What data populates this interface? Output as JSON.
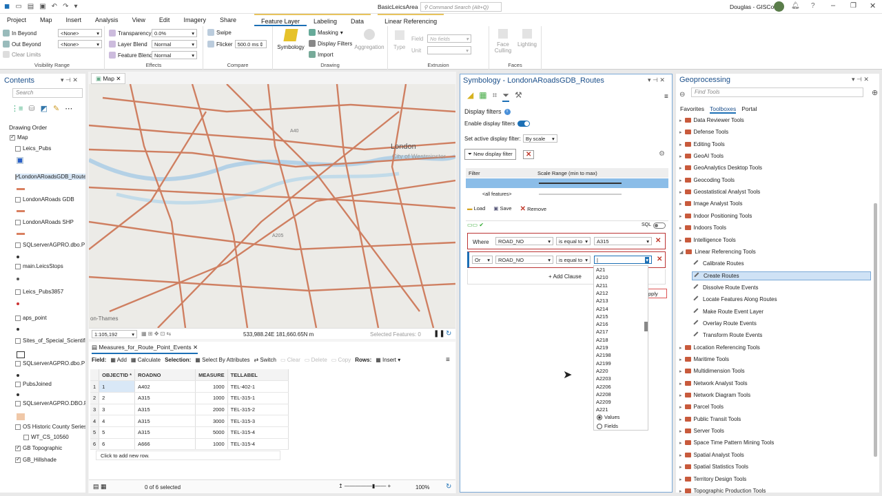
{
  "app": {
    "project_name": "BasicLeicsArea",
    "command_search_placeholder": "Command Search (Alt+Q)",
    "user": "Douglas - GISCo"
  },
  "tabs": [
    "Project",
    "Map",
    "Insert",
    "Analysis",
    "View",
    "Edit",
    "Imagery",
    "Share",
    "Feature Layer",
    "Labeling",
    "Data",
    "Linear Referencing"
  ],
  "ribbon": {
    "visibility_range": {
      "label": "Visibility Range",
      "in_beyond": "In Beyond",
      "out_beyond": "Out Beyond",
      "clear_limits": "Clear Limits",
      "in_value": "<None>",
      "out_value": "<None>"
    },
    "effects": {
      "label": "Effects",
      "transparency": "Transparency",
      "transparency_value": "0.0%",
      "layer_blend": "Layer Blend",
      "layer_blend_value": "Normal",
      "feature_blend": "Feature Blend",
      "feature_blend_value": "Normal"
    },
    "compare": {
      "label": "Compare",
      "swipe": "Swipe",
      "flicker": "Flicker",
      "flicker_value": "500.0 ms"
    },
    "drawing": {
      "label": "Drawing",
      "symbology": "Symbology",
      "masking": "Masking",
      "display_filters": "Display Filters",
      "import": "Import",
      "aggregation": "Aggregation"
    },
    "extrusion": {
      "label": "Extrusion",
      "type": "Type",
      "field": "Field",
      "field_value": "No fields",
      "unit": "Unit"
    },
    "faces": {
      "label": "Faces",
      "face_culling": "Face Culling",
      "lighting": "Lighting"
    }
  },
  "contents": {
    "title": "Contents",
    "search_placeholder": "Search",
    "drawing_order": "Drawing Order",
    "layers": [
      {
        "name": "Map",
        "checked": true
      },
      {
        "name": "Leics_Pubs",
        "checked": false
      },
      {
        "name": "LondonARoadsGDB_Route",
        "checked": true
      },
      {
        "name": "LondonARoads GDB",
        "checked": false
      },
      {
        "name": "LondonARoads SHP",
        "checked": false
      },
      {
        "name": "SQLserverAGPRO.dbo.P",
        "checked": false
      },
      {
        "name": "main.LeicsStops",
        "checked": false
      },
      {
        "name": "Leics_Pubs3857",
        "checked": false
      },
      {
        "name": "aps_point",
        "checked": false
      },
      {
        "name": "Sites_of_Special_Scientific",
        "checked": false
      },
      {
        "name": "SQLserverAGPRO.dbo.P",
        "checked": false
      },
      {
        "name": "PubsJoined",
        "checked": false
      },
      {
        "name": "SQLserverAGPRO.DBO.P",
        "checked": false
      },
      {
        "name": "OS Historic County Series",
        "checked": false
      },
      {
        "name": "WT_CS_10560",
        "checked": false
      },
      {
        "name": "GB Topographic",
        "checked": true
      },
      {
        "name": "GB_Hillshade",
        "checked": true
      }
    ]
  },
  "map": {
    "tab": "Map",
    "scale": "1:105,192",
    "coords": "533,988.24E 181,660.65N m",
    "selected": "Selected Features: 0",
    "labels": {
      "london": "London",
      "westminster": "City of Westminster",
      "thames": "on-Thames",
      "a40": "A40",
      "a205": "A205"
    }
  },
  "table": {
    "tab": "Measures_for_Route_Point_Events",
    "toolbar": {
      "field": "Field:",
      "add": "Add",
      "calculate": "Calculate",
      "selection": "Selection:",
      "select_by_attr": "Select By Attributes",
      "switch": "Switch",
      "clear": "Clear",
      "delete": "Delete",
      "copy": "Copy",
      "rows": "Rows:",
      "insert": "Insert"
    },
    "columns": [
      "OBJECTID *",
      "ROADNO",
      "MEASURE",
      "TELLABEL"
    ],
    "rows": [
      [
        "1",
        "A402",
        "1000",
        "TEL-402-1"
      ],
      [
        "2",
        "A315",
        "1000",
        "TEL-315-1"
      ],
      [
        "3",
        "A315",
        "2000",
        "TEL-315-2"
      ],
      [
        "4",
        "A315",
        "3000",
        "TEL-315-3"
      ],
      [
        "5",
        "A315",
        "5000",
        "TEL-315-4"
      ],
      [
        "6",
        "A666",
        "1000",
        "TEL-315-4"
      ]
    ],
    "add_row": "Click to add new row.",
    "status": "0 of 6 selected",
    "zoom": "100%"
  },
  "symbology": {
    "title": "Symbology - LondonARoadsGDB_Routes",
    "section": "Display filters",
    "enable": "Enable display filters",
    "set_active": "Set active display filter:",
    "active_value": "By scale",
    "new_filter": "New display filter",
    "col_filter": "Filter",
    "col_scale": "Scale Range (min to max)",
    "all_features": "<all features>",
    "load": "Load",
    "save": "Save",
    "remove": "Remove",
    "sql": "SQL",
    "clause1": {
      "prefix": "Where",
      "field": "ROAD_NO",
      "op": "is equal to",
      "value": "A315"
    },
    "clause2": {
      "prefix": "Or",
      "field": "ROAD_NO",
      "op": "is equal to",
      "value": "|"
    },
    "add_clause": "Add Clause",
    "apply": "pply",
    "dropdown": [
      "A21",
      "A210",
      "A211",
      "A212",
      "A213",
      "A214",
      "A215",
      "A216",
      "A217",
      "A218",
      "A219",
      "A2198",
      "A2199",
      "A220",
      "A2203",
      "A2206",
      "A2208",
      "A2209",
      "A221"
    ],
    "values": "Values",
    "fields": "Fields"
  },
  "geoprocessing": {
    "title": "Geoprocessing",
    "search_placeholder": "Find Tools",
    "tabs": [
      "Favorites",
      "Toolboxes",
      "Portal"
    ],
    "items": [
      {
        "t": "box",
        "n": "Data Reviewer Tools"
      },
      {
        "t": "box",
        "n": "Defense Tools"
      },
      {
        "t": "box",
        "n": "Editing Tools"
      },
      {
        "t": "box",
        "n": "GeoAI Tools"
      },
      {
        "t": "box",
        "n": "GeoAnalytics Desktop Tools"
      },
      {
        "t": "box",
        "n": "Geocoding Tools"
      },
      {
        "t": "box",
        "n": "Geostatistical Analyst Tools"
      },
      {
        "t": "box",
        "n": "Image Analyst Tools"
      },
      {
        "t": "box",
        "n": "Indoor Positioning Tools"
      },
      {
        "t": "box",
        "n": "Indoors Tools"
      },
      {
        "t": "box",
        "n": "Intelligence Tools"
      },
      {
        "t": "open",
        "n": "Linear Referencing Tools"
      },
      {
        "t": "tool",
        "n": "Calibrate Routes"
      },
      {
        "t": "sel",
        "n": "Create Routes"
      },
      {
        "t": "tool",
        "n": "Dissolve Route Events"
      },
      {
        "t": "tool",
        "n": "Locate Features Along Routes"
      },
      {
        "t": "tool",
        "n": "Make Route Event Layer"
      },
      {
        "t": "tool",
        "n": "Overlay Route Events"
      },
      {
        "t": "tool",
        "n": "Transform Route Events"
      },
      {
        "t": "box",
        "n": "Location Referencing Tools"
      },
      {
        "t": "box",
        "n": "Maritime Tools"
      },
      {
        "t": "box",
        "n": "Multidimension Tools"
      },
      {
        "t": "box",
        "n": "Network Analyst Tools"
      },
      {
        "t": "box",
        "n": "Network Diagram Tools"
      },
      {
        "t": "box",
        "n": "Parcel Tools"
      },
      {
        "t": "box",
        "n": "Public Transit Tools"
      },
      {
        "t": "box",
        "n": "Server Tools"
      },
      {
        "t": "box",
        "n": "Space Time Pattern Mining Tools"
      },
      {
        "t": "box",
        "n": "Spatial Analyst Tools"
      },
      {
        "t": "box",
        "n": "Spatial Statistics Tools"
      },
      {
        "t": "box",
        "n": "Territory Design Tools"
      },
      {
        "t": "box",
        "n": "Topographic Production Tools"
      }
    ]
  }
}
